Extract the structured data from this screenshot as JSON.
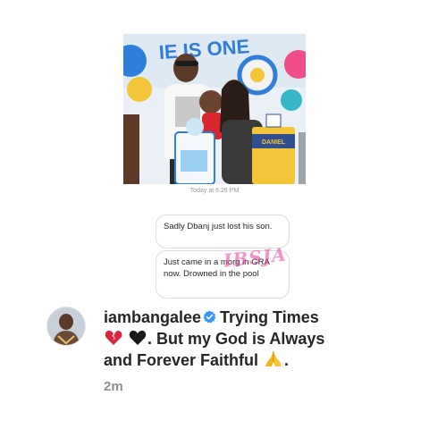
{
  "dm": {
    "timestamp": "Today at 6:26 PM",
    "photo_banner_text": "IE IS ONE",
    "cake_label": "DANIEL",
    "messages": [
      {
        "text": "Sadly Dbanj just lost his son."
      },
      {
        "text": "Just came in a morg in GRA now. Drowned in the pool"
      }
    ],
    "watermark": "IBSJA"
  },
  "comment": {
    "username": "iambangalee",
    "verified": true,
    "line_1": "Trying Times",
    "line_2": ". But my God is Always",
    "line_3": "and Forever Faithful",
    "line_4": ".",
    "age": "2m"
  },
  "icons": {
    "verified": "verified-badge-icon",
    "broken_heart": "broken-heart-emoji",
    "black_heart": "black-heart-emoji",
    "praying_hands": "praying-hands-emoji"
  },
  "colors": {
    "verified_blue": "#3897f0",
    "broken_heart_red": "#d9263f",
    "text_dark": "#262626",
    "muted_gray": "#8e8e8e"
  }
}
